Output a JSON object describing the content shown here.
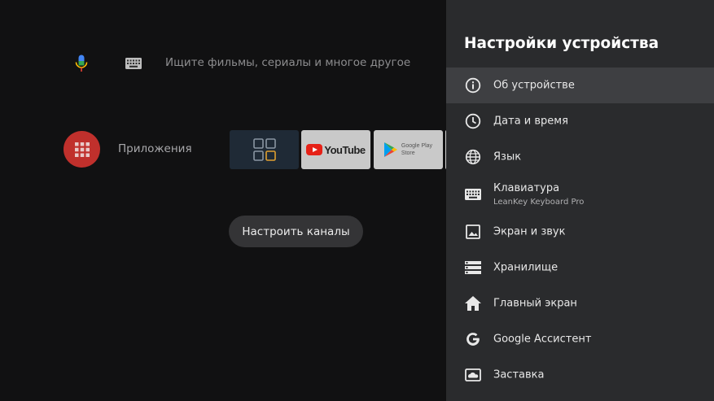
{
  "launcher": {
    "search_placeholder": "Ищите фильмы, сериалы и многое другое",
    "apps_label": "Приложения",
    "tiles": {
      "youtube": "YouTube",
      "play_line1": "Google Play",
      "play_line2": "Store"
    },
    "channels_button": "Настроить каналы",
    "icons": {
      "mic": "microphone-icon",
      "keyboard": "keyboard-icon",
      "apps": "grid-icon"
    }
  },
  "settings": {
    "title": "Настройки устройства",
    "items": [
      {
        "label": "Об устройстве",
        "icon": "info-icon",
        "selected": true
      },
      {
        "label": "Дата и время",
        "icon": "clock-icon"
      },
      {
        "label": "Язык",
        "icon": "globe-icon"
      },
      {
        "label": "Клавиатура",
        "sublabel": "LeanKey Keyboard Pro",
        "icon": "keyboard-icon"
      },
      {
        "label": "Экран и звук",
        "icon": "image-icon"
      },
      {
        "label": "Хранилище",
        "icon": "storage-icon"
      },
      {
        "label": "Главный экран",
        "icon": "home-icon"
      },
      {
        "label": "Google Ассистент",
        "icon": "google-icon"
      },
      {
        "label": "Заставка",
        "icon": "screensaver-icon"
      }
    ]
  },
  "colors": {
    "background": "#111112",
    "panel": "#2a2b2d",
    "selected_row": "#3e3f42",
    "apps_circle": "#c0302c",
    "channels_button": "#343436"
  }
}
